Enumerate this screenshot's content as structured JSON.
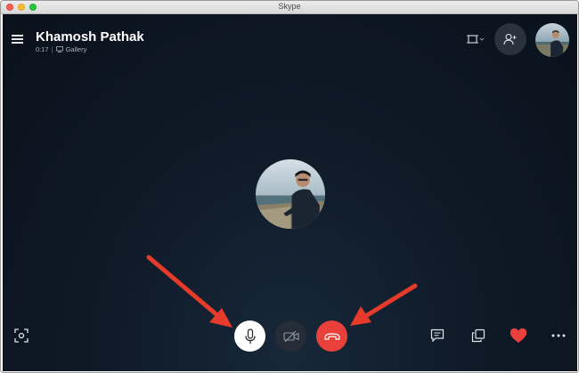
{
  "window": {
    "title": "Skype"
  },
  "call": {
    "caller_name": "Khamosh Pathak",
    "duration": "0:17",
    "separator": "|",
    "view_mode": "Gallery"
  },
  "icons": {
    "menu": "hamburger-menu-icon",
    "layout": "layout-toggle-icon",
    "add_person": "add-person-icon",
    "gallery": "gallery-icon",
    "screenshot": "screenshot-icon",
    "mic": "microphone-icon",
    "video": "video-off-icon",
    "end_call": "end-call-icon",
    "chat": "chat-icon",
    "share": "share-screen-icon",
    "react": "heart-icon",
    "more": "more-options-icon"
  },
  "colors": {
    "end_call": "#e8403a",
    "heart": "#e8403a",
    "annotation_arrow": "#e63a2a",
    "background": "#0f1a28"
  }
}
